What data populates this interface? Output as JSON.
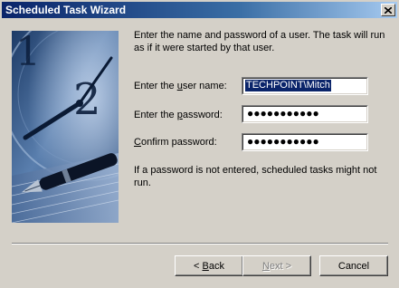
{
  "window": {
    "title": "Scheduled Task Wizard"
  },
  "intro_text": "Enter the name and password of a user.  The task will run as if it were started by that user.",
  "fields": {
    "username": {
      "label_pre": "Enter the ",
      "label_ul": "u",
      "label_post": "ser name:",
      "value": "TECHPOINT\\Mitch"
    },
    "password": {
      "label_pre": "Enter the ",
      "label_ul": "p",
      "label_post": "assword:",
      "value": "●●●●●●●●●●●"
    },
    "confirm": {
      "label_pre": "",
      "label_ul": "C",
      "label_post": "onfirm password:",
      "value": "●●●●●●●●●●●"
    }
  },
  "note_text": "If a password is not entered, scheduled tasks might not run.",
  "buttons": {
    "back_ul": "< ",
    "back_ul_letter": "B",
    "back_rest": "ack",
    "next_pre": "",
    "next_ul_letter": "N",
    "next_rest": "ext >",
    "cancel": "Cancel"
  },
  "icons": {
    "close": "close-icon",
    "illustration": "clock-and-pen-illustration"
  }
}
